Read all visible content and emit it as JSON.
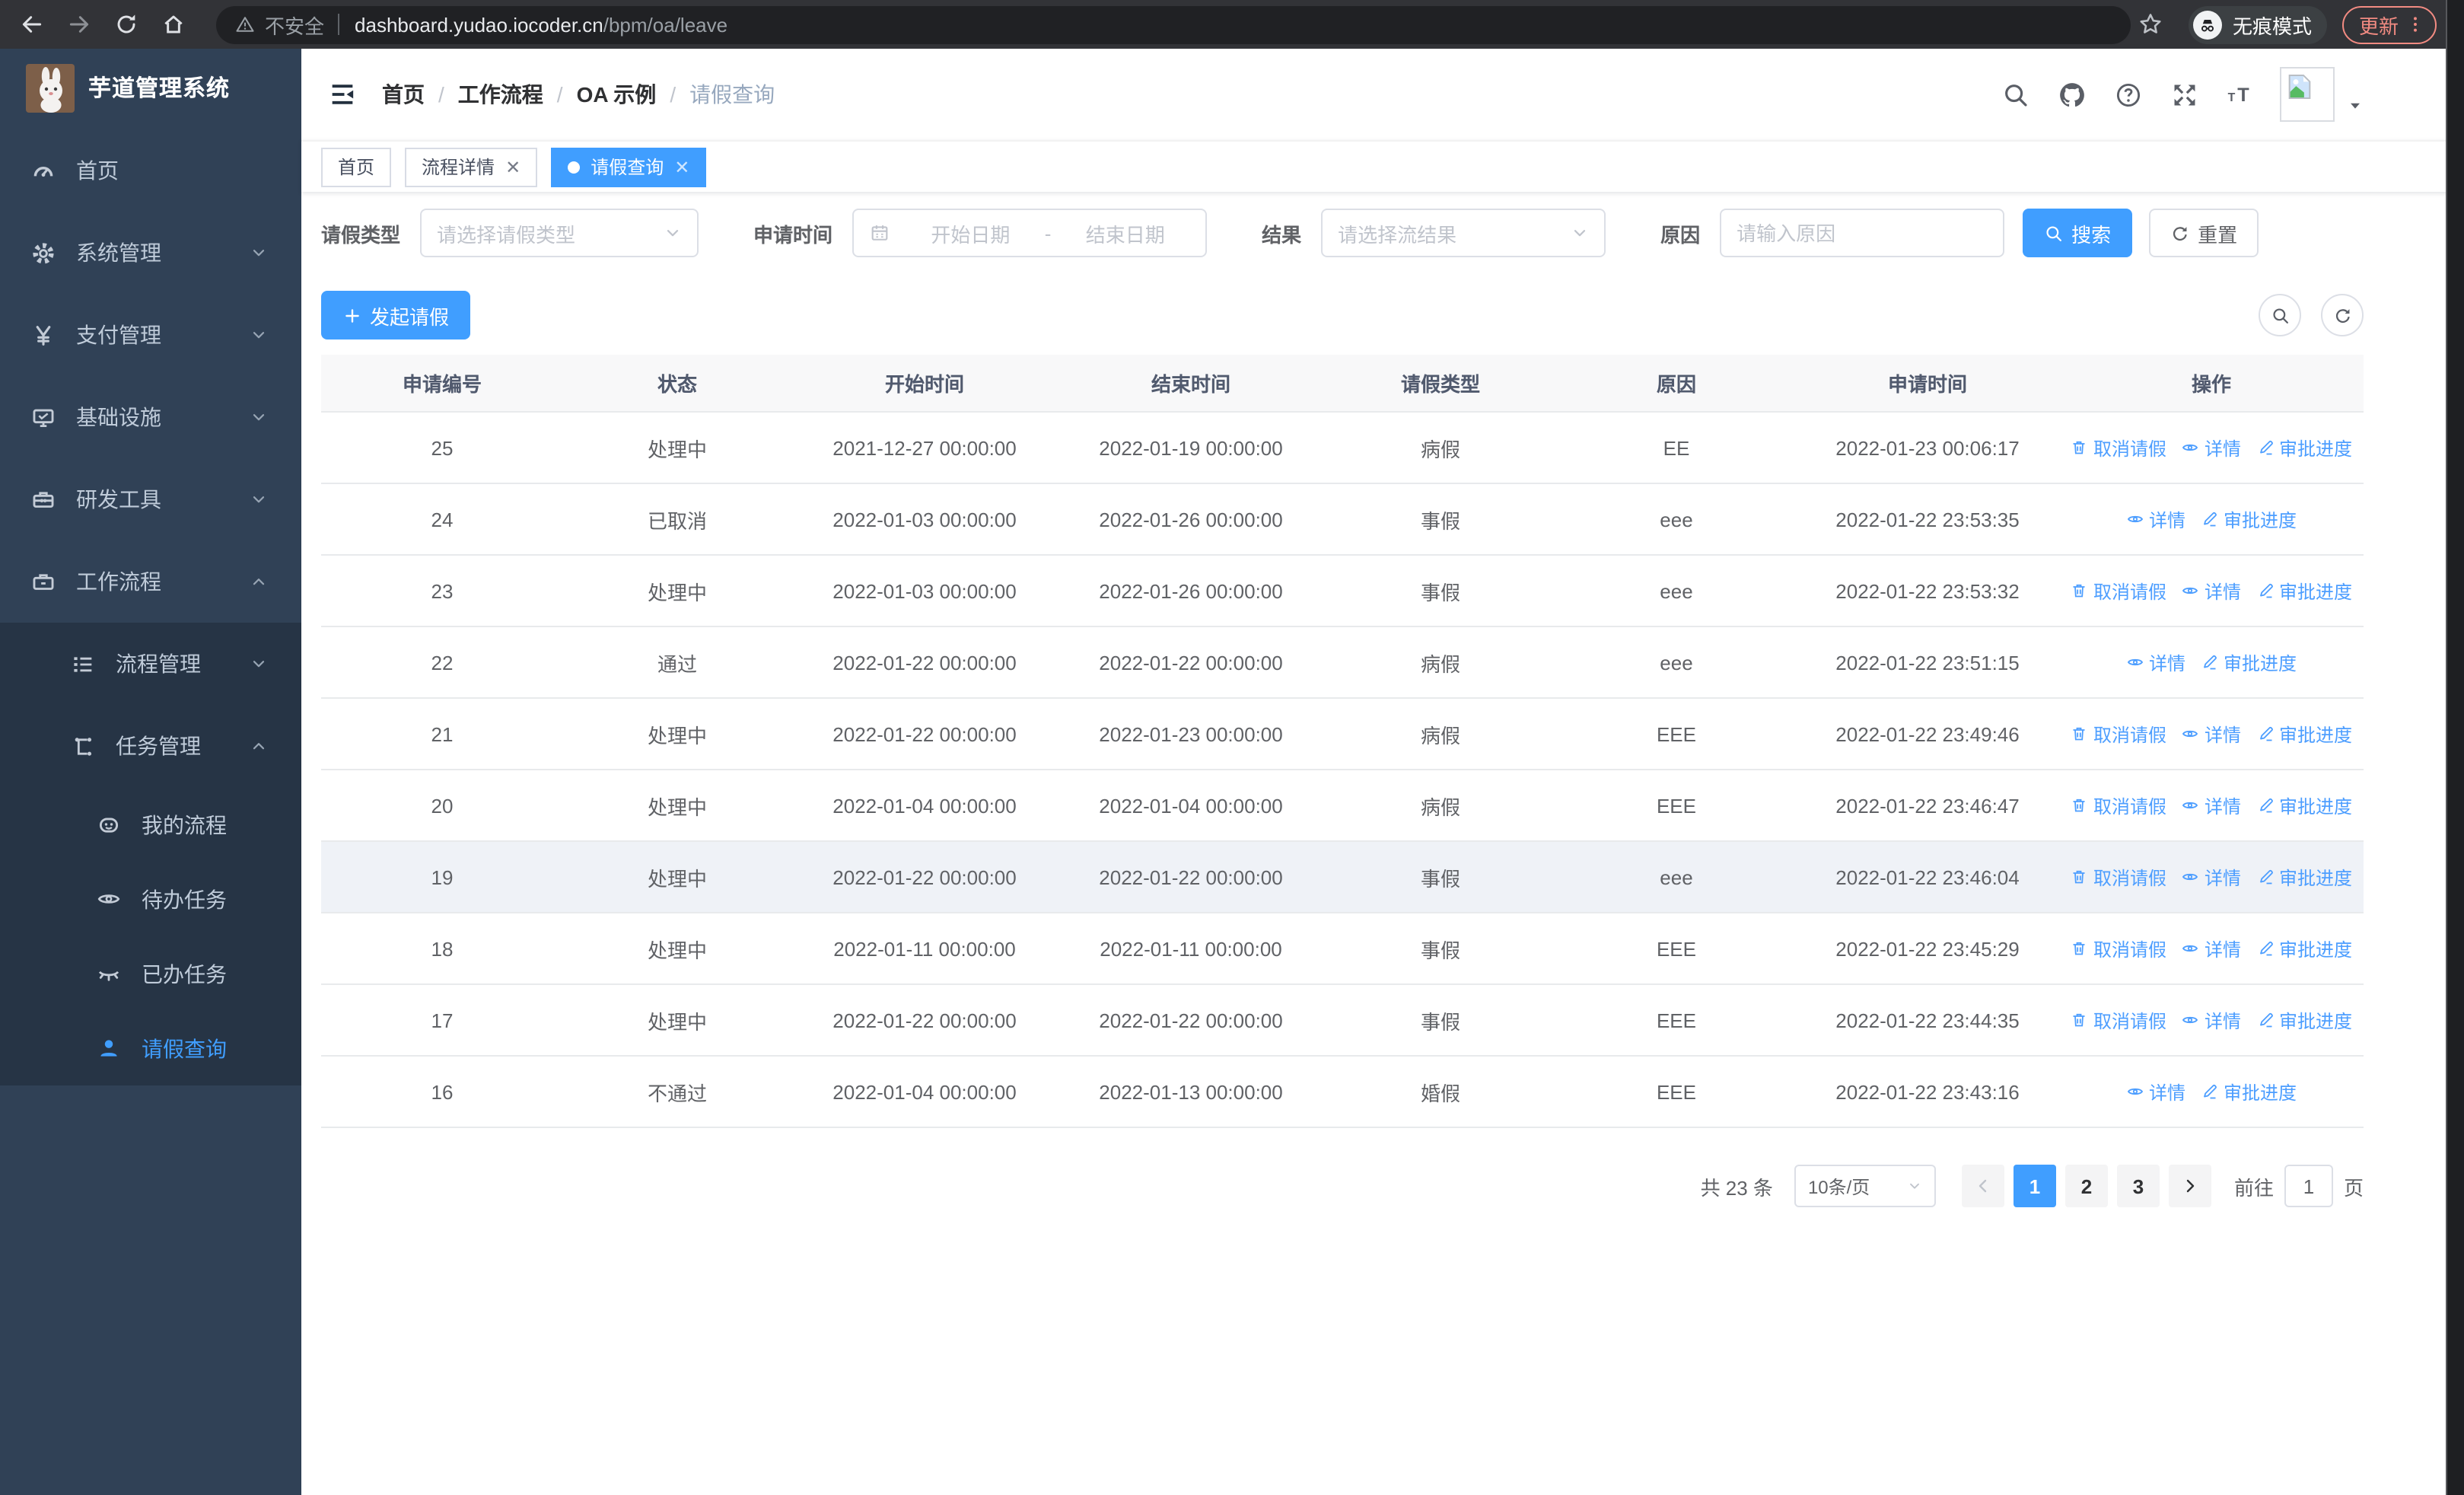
{
  "colors": {
    "primary": "#409EFF",
    "link": "#4D9EFF",
    "sidebar": "#304156",
    "sidebar-sub": "#263445"
  },
  "browser": {
    "insecure_label": "不安全",
    "host": "dashboard.yudao.iocoder.cn",
    "path": "/bpm/oa/leave",
    "incognito_label": "无痕模式",
    "update_label": "更新",
    "nav_icons": [
      "back",
      "forward",
      "reload",
      "home"
    ]
  },
  "app": {
    "title": "芋道管理系统"
  },
  "sidebar": {
    "items": [
      {
        "key": "home",
        "label": "首页",
        "icon": "dashboard",
        "level": 0
      },
      {
        "key": "system",
        "label": "系统管理",
        "icon": "gear",
        "level": 0,
        "arrow": "down"
      },
      {
        "key": "payment",
        "label": "支付管理",
        "icon": "yen",
        "level": 0,
        "arrow": "down"
      },
      {
        "key": "infra",
        "label": "基础设施",
        "icon": "monitor",
        "level": 0,
        "arrow": "down"
      },
      {
        "key": "dev-tools",
        "label": "研发工具",
        "icon": "toolbox",
        "level": 0,
        "arrow": "down"
      },
      {
        "key": "workflow",
        "label": "工作流程",
        "icon": "briefcase",
        "level": 0,
        "arrow": "up"
      },
      {
        "key": "process-mgmt",
        "label": "流程管理",
        "icon": "list",
        "level": 1,
        "arrow": "down",
        "sub": true
      },
      {
        "key": "task-mgmt",
        "label": "任务管理",
        "icon": "flow",
        "level": 1,
        "arrow": "up",
        "sub": true
      },
      {
        "key": "my-process",
        "label": "我的流程",
        "icon": "robot",
        "level": 2,
        "sub": true
      },
      {
        "key": "todo-tasks",
        "label": "待办任务",
        "icon": "eye",
        "level": 2,
        "sub": true
      },
      {
        "key": "done-tasks",
        "label": "已办任务",
        "icon": "eye-closed",
        "level": 2,
        "sub": true
      },
      {
        "key": "leave-query",
        "label": "请假查询",
        "icon": "user",
        "level": 2,
        "sub": true,
        "active": true
      }
    ]
  },
  "header": {
    "separator": "/",
    "breadcrumb": [
      {
        "label": "首页"
      },
      {
        "label": "工作流程"
      },
      {
        "label": "OA 示例"
      },
      {
        "label": "请假查询",
        "current": true
      }
    ],
    "icons": [
      "search",
      "github",
      "help",
      "expand",
      "font-size"
    ]
  },
  "tabs": [
    {
      "key": "home",
      "label": "首页",
      "closable": false,
      "active": false
    },
    {
      "key": "process-detail",
      "label": "流程详情",
      "closable": true,
      "active": false
    },
    {
      "key": "leave-query",
      "label": "请假查询",
      "closable": true,
      "active": true
    }
  ],
  "filters": {
    "type_label": "请假类型",
    "type_placeholder": "请选择请假类型",
    "time_label": "申请时间",
    "date_start_placeholder": "开始日期",
    "date_separator": "-",
    "date_end_placeholder": "结束日期",
    "result_label": "结果",
    "result_placeholder": "请选择流结果",
    "reason_label": "原因",
    "reason_placeholder": "请输入原因",
    "search_label": "搜索",
    "reset_label": "重置"
  },
  "toolbar": {
    "create_label": "发起请假"
  },
  "table": {
    "columns": [
      "申请编号",
      "状态",
      "开始时间",
      "结束时间",
      "请假类型",
      "原因",
      "申请时间",
      "操作"
    ],
    "action_labels": {
      "cancel": "取消请假",
      "detail": "详情",
      "progress": "审批进度"
    },
    "action_icons": {
      "cancel": "trash",
      "detail": "eye",
      "progress": "edit"
    },
    "rows": [
      {
        "id": "25",
        "status": "处理中",
        "start": "2021-12-27 00:00:00",
        "end": "2022-01-19 00:00:00",
        "type": "病假",
        "reason": "EE",
        "apply": "2022-01-23 00:06:17",
        "cancelable": true,
        "highlight": false
      },
      {
        "id": "24",
        "status": "已取消",
        "start": "2022-01-03 00:00:00",
        "end": "2022-01-26 00:00:00",
        "type": "事假",
        "reason": "eee",
        "apply": "2022-01-22 23:53:35",
        "cancelable": false,
        "highlight": false
      },
      {
        "id": "23",
        "status": "处理中",
        "start": "2022-01-03 00:00:00",
        "end": "2022-01-26 00:00:00",
        "type": "事假",
        "reason": "eee",
        "apply": "2022-01-22 23:53:32",
        "cancelable": true,
        "highlight": false
      },
      {
        "id": "22",
        "status": "通过",
        "start": "2022-01-22 00:00:00",
        "end": "2022-01-22 00:00:00",
        "type": "病假",
        "reason": "eee",
        "apply": "2022-01-22 23:51:15",
        "cancelable": false,
        "highlight": false
      },
      {
        "id": "21",
        "status": "处理中",
        "start": "2022-01-22 00:00:00",
        "end": "2022-01-23 00:00:00",
        "type": "病假",
        "reason": "EEE",
        "apply": "2022-01-22 23:49:46",
        "cancelable": true,
        "highlight": false
      },
      {
        "id": "20",
        "status": "处理中",
        "start": "2022-01-04 00:00:00",
        "end": "2022-01-04 00:00:00",
        "type": "病假",
        "reason": "EEE",
        "apply": "2022-01-22 23:46:47",
        "cancelable": true,
        "highlight": false
      },
      {
        "id": "19",
        "status": "处理中",
        "start": "2022-01-22 00:00:00",
        "end": "2022-01-22 00:00:00",
        "type": "事假",
        "reason": "eee",
        "apply": "2022-01-22 23:46:04",
        "cancelable": true,
        "highlight": true
      },
      {
        "id": "18",
        "status": "处理中",
        "start": "2022-01-11 00:00:00",
        "end": "2022-01-11 00:00:00",
        "type": "事假",
        "reason": "EEE",
        "apply": "2022-01-22 23:45:29",
        "cancelable": true,
        "highlight": false
      },
      {
        "id": "17",
        "status": "处理中",
        "start": "2022-01-22 00:00:00",
        "end": "2022-01-22 00:00:00",
        "type": "事假",
        "reason": "EEE",
        "apply": "2022-01-22 23:44:35",
        "cancelable": true,
        "highlight": false
      },
      {
        "id": "16",
        "status": "不通过",
        "start": "2022-01-04 00:00:00",
        "end": "2022-01-13 00:00:00",
        "type": "婚假",
        "reason": "EEE",
        "apply": "2022-01-22 23:43:16",
        "cancelable": false,
        "highlight": false
      }
    ]
  },
  "pagination": {
    "total": "共 23 条",
    "page_size": "10条/页",
    "pages": [
      "1",
      "2",
      "3"
    ],
    "active_page": "1",
    "goto_label": "前往",
    "goto_value": "1",
    "page_unit": "页"
  }
}
